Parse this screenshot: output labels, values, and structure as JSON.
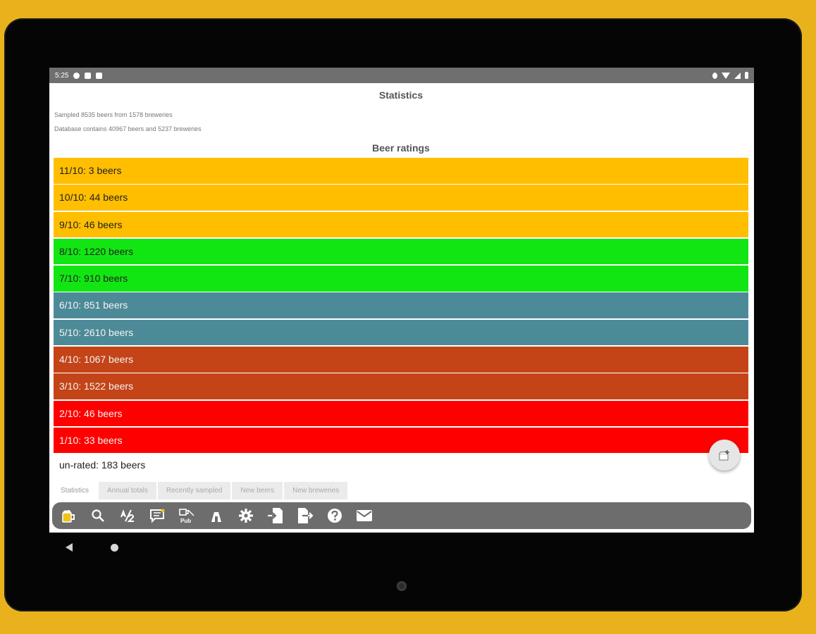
{
  "status_bar": {
    "time": "5:25"
  },
  "statistics": {
    "title": "Statistics",
    "sampled_line": "Sampled 8535 beers from 1578 breweries",
    "database_line": "Database contains 40967 beers and 5237 breweries"
  },
  "beer_ratings": {
    "title": "Beer ratings",
    "rows": [
      {
        "label": "11/10: 3 beers",
        "color": "#ffbe00",
        "text_color": "dark"
      },
      {
        "label": "10/10: 44 beers",
        "color": "#ffbe00",
        "text_color": "dark"
      },
      {
        "label": "9/10: 46 beers",
        "color": "#ffbe00",
        "text_color": "dark"
      },
      {
        "label": "8/10: 1220 beers",
        "color": "#12e612",
        "text_color": "dark"
      },
      {
        "label": "7/10: 910 beers",
        "color": "#12e612",
        "text_color": "dark"
      },
      {
        "label": "6/10: 851 beers",
        "color": "#4d8a98",
        "text_color": "light"
      },
      {
        "label": "5/10: 2610 beers",
        "color": "#4d8a98",
        "text_color": "light"
      },
      {
        "label": "4/10: 1067 beers",
        "color": "#c44418",
        "text_color": "light"
      },
      {
        "label": "3/10: 1522 beers",
        "color": "#c44418",
        "text_color": "light"
      },
      {
        "label": "2/10: 46 beers",
        "color": "#ff0000",
        "text_color": "light"
      },
      {
        "label": "1/10: 33 beers",
        "color": "#ff0000",
        "text_color": "light"
      }
    ],
    "unrated": "un-rated: 183 beers"
  },
  "tabs": [
    {
      "label": "Statistics",
      "active": true
    },
    {
      "label": "Annual totals",
      "active": false
    },
    {
      "label": "Recently sampled",
      "active": false
    },
    {
      "label": "New beers",
      "active": false
    },
    {
      "label": "New breweries",
      "active": false
    }
  ],
  "fab": {
    "icon": "add-beer-icon"
  },
  "toolbar": {
    "icons": [
      "beer-mug-icon",
      "search-icon",
      "half-rating-icon",
      "comment-icon",
      "pub-icon",
      "brewery-icon",
      "gear-icon",
      "import-icon",
      "export-icon",
      "help-icon",
      "mail-icon"
    ],
    "pub_label": "Pub"
  },
  "colors": {
    "background": "#e9b21c",
    "bezel": "#050505",
    "status_bar": "#6f6f6f",
    "toolbar": "#6d6d6d"
  }
}
